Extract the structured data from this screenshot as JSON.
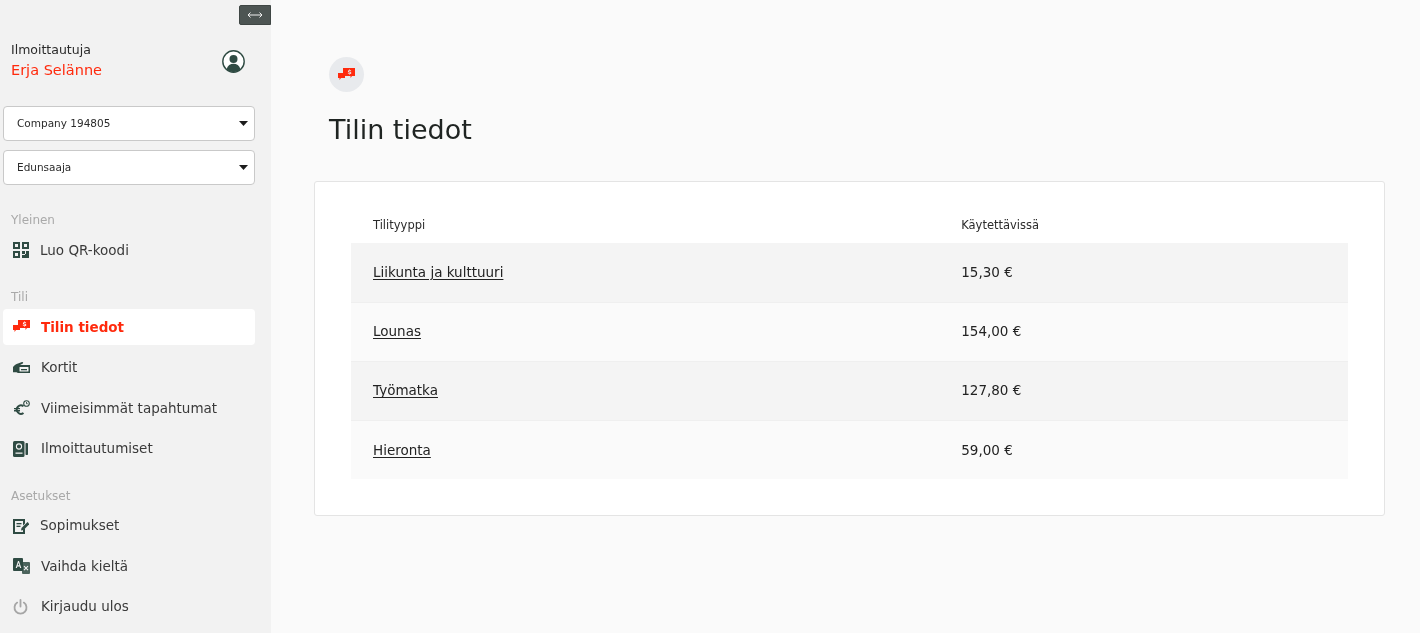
{
  "sidebar": {
    "user": {
      "role": "Ilmoittautuja",
      "name": "Erja Selänne"
    },
    "dropdowns": [
      {
        "value": "Company 194805"
      },
      {
        "value": "Edunsaaja"
      }
    ],
    "sections": [
      {
        "title": "Yleinen",
        "items": [
          {
            "label": "Luo QR-koodi",
            "selected": false
          }
        ]
      },
      {
        "title": "Tili",
        "items": [
          {
            "label": "Tilin tiedot",
            "selected": true
          },
          {
            "label": "Kortit",
            "selected": false
          },
          {
            "label": "Viimeisimmät tapahtumat",
            "selected": false
          },
          {
            "label": "Ilmoittautumiset",
            "selected": false
          }
        ]
      },
      {
        "title": "Asetukset",
        "items": [
          {
            "label": "Sopimukset",
            "selected": false
          },
          {
            "label": "Vaihda kieltä",
            "selected": false
          },
          {
            "label": "Kirjaudu ulos",
            "selected": false
          }
        ]
      }
    ]
  },
  "page": {
    "title": "Tilin tiedot"
  },
  "table": {
    "columns": [
      "Tilityyppi",
      "Käytettävissä"
    ],
    "rows": [
      {
        "account_type": "Liikunta ja kulttuuri",
        "available": "15,30 €"
      },
      {
        "account_type": "Lounas",
        "available": "154,00 €"
      },
      {
        "account_type": "Työmatka",
        "available": "127,80 €"
      },
      {
        "account_type": "Hieronta",
        "available": "59,00 €"
      }
    ]
  }
}
